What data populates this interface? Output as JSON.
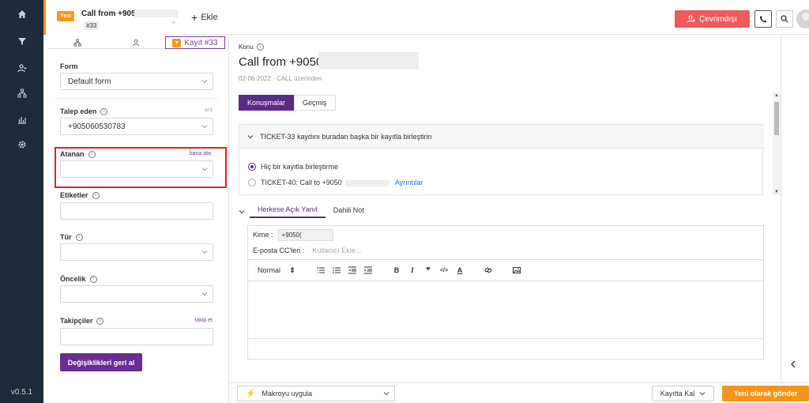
{
  "nav": {
    "items": [
      "home-icon",
      "funnel-icon",
      "users-icon",
      "hierarchy-icon",
      "bar-chart-icon",
      "gear-icon"
    ],
    "version": "v0.5.1"
  },
  "topbar": {
    "tab": {
      "badge": "Yeni",
      "title": "Call from +9050",
      "id": "#33"
    },
    "add_label": "Ekle",
    "offline_label": "Çevrimdışı"
  },
  "left": {
    "subtab_record": "Kayıt #33",
    "form": {
      "label": "Form",
      "value": "Default form"
    },
    "requester": {
      "label": "Talep eden",
      "action": "ara",
      "value": "+905060530783"
    },
    "assignee": {
      "label": "Atanan",
      "action": "bana ata",
      "value": ""
    },
    "tags": {
      "label": "Etiketler",
      "value": ""
    },
    "type": {
      "label": "Tür",
      "value": ""
    },
    "priority": {
      "label": "Öncelik",
      "value": ""
    },
    "followers": {
      "label": "Takipçiler",
      "action": "takip et",
      "value": ""
    },
    "revert_label": "Değişiklikleri geri al"
  },
  "main": {
    "subject_label": "Konu",
    "subject": "Call from +9050(",
    "meta": "02-06-2022 - CALL üzerinden",
    "tabs": [
      "Konuşmalar",
      "Geçmiş"
    ],
    "merge": {
      "header": "TICKET-33 kaydını buradan başka bir kayıtla birleştirin",
      "option_none": "Hiç bir kayıtla birleştirme",
      "option_ticket": "TICKET-40: Call to +9050",
      "details_link": "Ayrıntılar"
    },
    "reply_tabs": [
      "Herkese Açık Yanıt",
      "Dahili Not"
    ],
    "composer": {
      "to_label": "Kime :",
      "to_value": "+9050(",
      "cc_label": "E-posta CC'leri :",
      "cc_placeholder": "Kullanıcı Ekle...",
      "format_value": "Normal"
    }
  },
  "bottom": {
    "macro_label": "Makroyu uygula",
    "stay_label": "Kayıtta Kal",
    "send_label": "Yeni olarak gönder"
  }
}
